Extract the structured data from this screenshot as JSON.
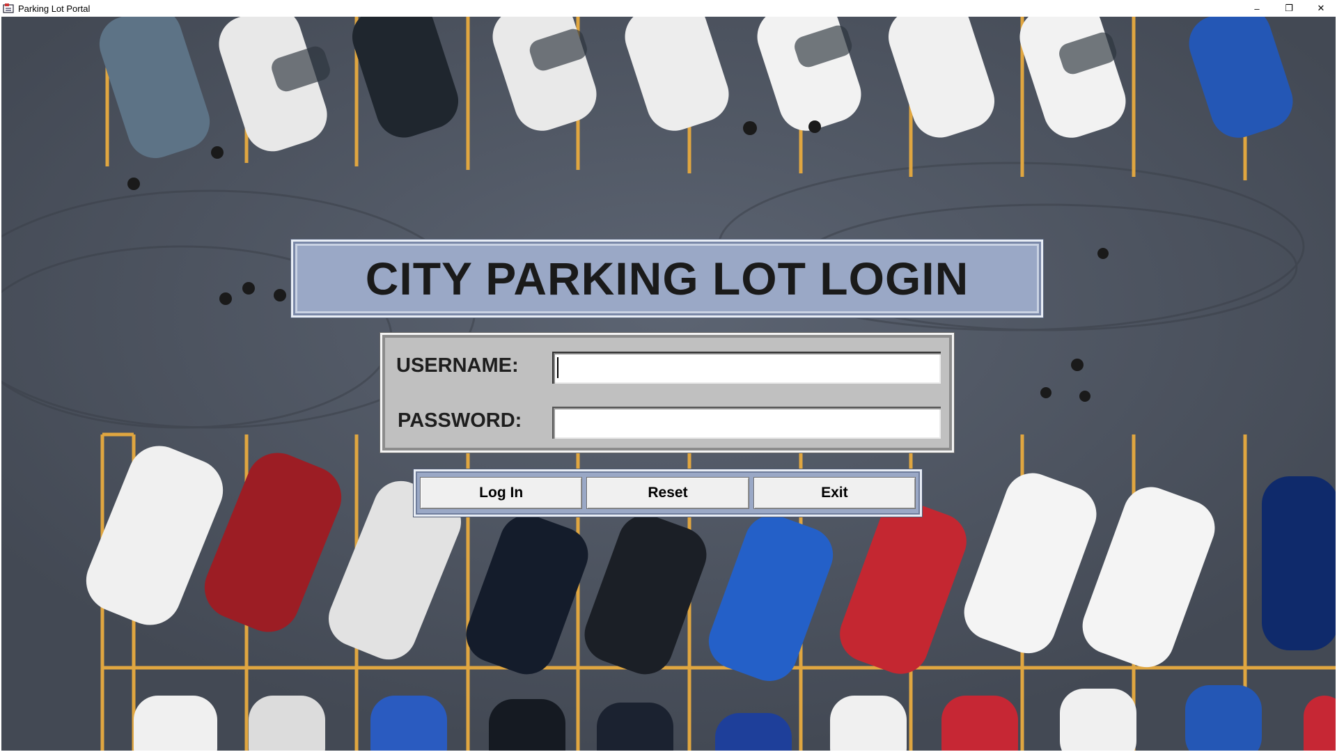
{
  "window": {
    "title": "Parking Lot Portal",
    "controls": {
      "minimize": "–",
      "restore": "❐",
      "close": "✕"
    },
    "icon": "parking-lot-app-icon"
  },
  "banner": {
    "title": "CITY PARKING LOT LOGIN"
  },
  "form": {
    "username_label": "USERNAME:",
    "username_value": "",
    "password_label": "PASSWORD:",
    "password_value": ""
  },
  "buttons": {
    "login": "Log In",
    "reset": "Reset",
    "exit": "Exit"
  },
  "colors": {
    "banner_bg": "#9aa8c6",
    "form_bg": "#c0c0c0",
    "asphalt": "#4b525e",
    "lot_line": "#e0a640"
  },
  "background_image": "aerial-parking-lot-photo"
}
